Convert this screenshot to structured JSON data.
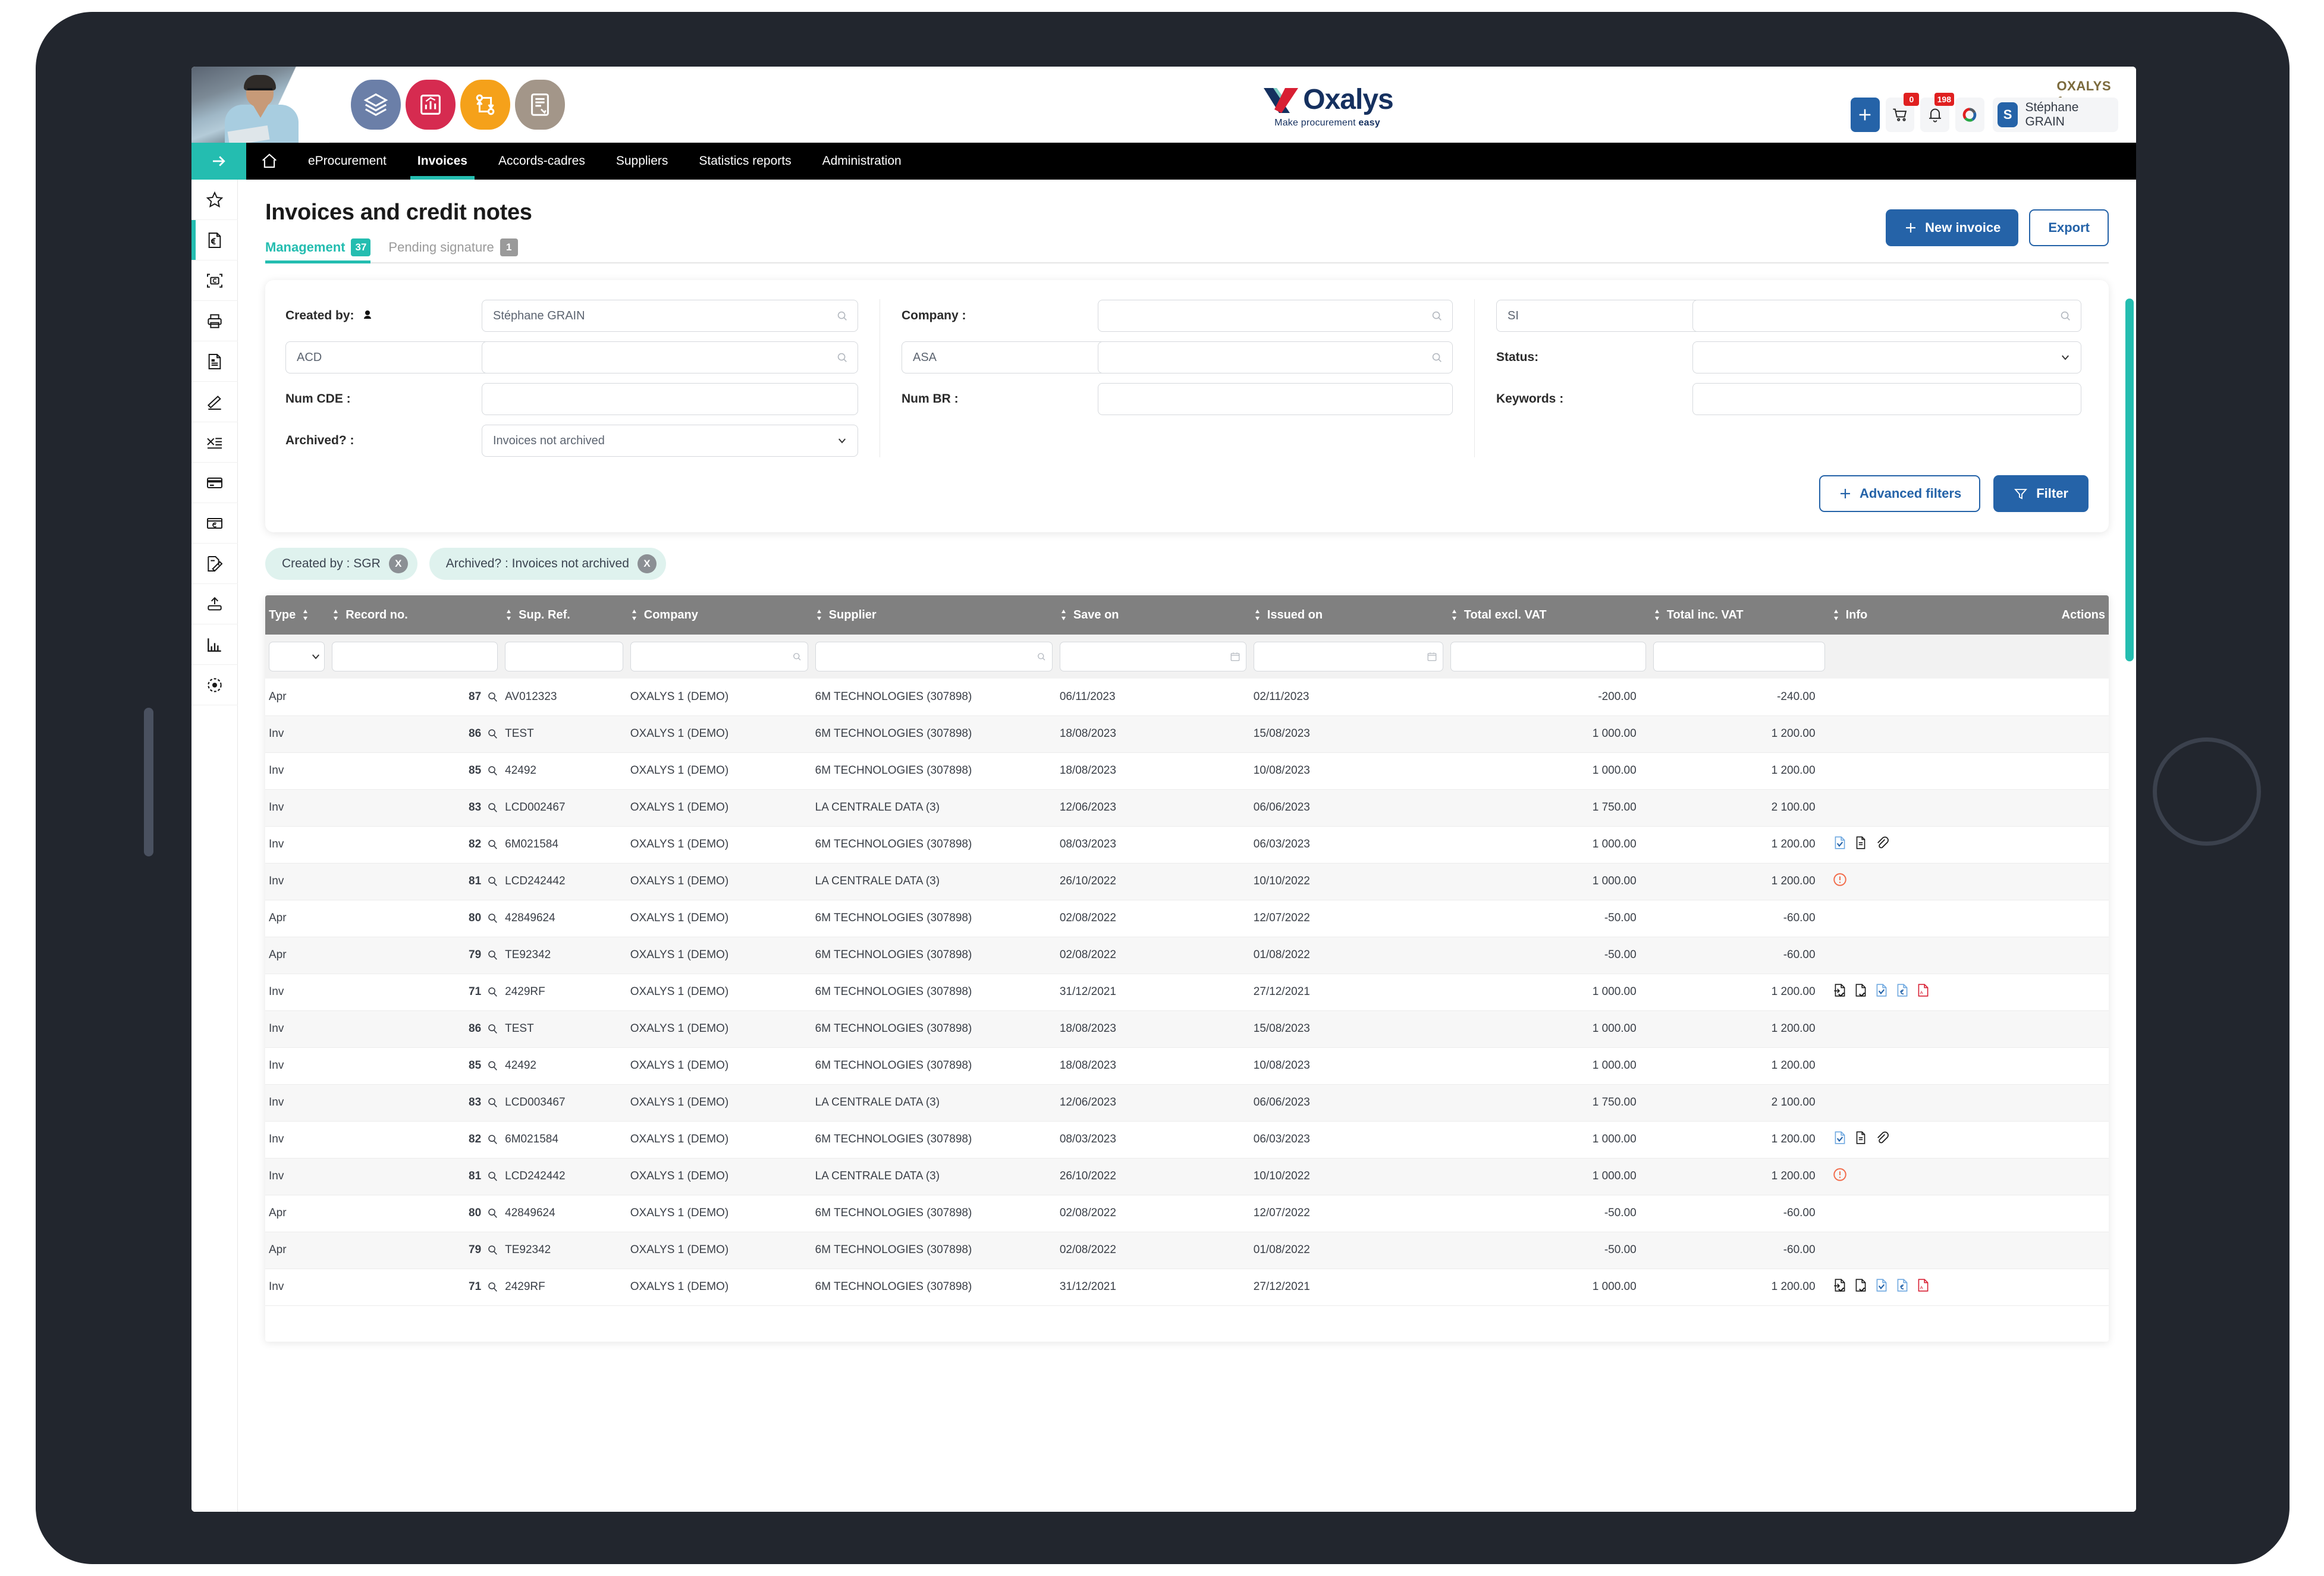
{
  "brand": {
    "logo_text": "Oxalys",
    "tagline_normal": "Make procurement ",
    "tagline_bold": "easy",
    "accent_teal": "#24bdb0",
    "accent_blue": "#2563a8",
    "nav_bg": "#000000",
    "header_row_bg": "#808080"
  },
  "topbar": {
    "org": "OXALYS 1",
    "cart_badge": "0",
    "bell_badge": "198",
    "user_initial": "S",
    "user_name": "Stéphane GRAIN",
    "app_icons": [
      "catalog-icon",
      "reports-icon",
      "workflow-icon",
      "contracts-icon"
    ]
  },
  "nav": {
    "toggle_icon": "arrow-right-icon",
    "home_icon": "home-icon",
    "items": [
      {
        "label": "eProcurement",
        "active": false
      },
      {
        "label": "Invoices",
        "active": true
      },
      {
        "label": "Accords-cadres",
        "active": false
      },
      {
        "label": "Suppliers",
        "active": false
      },
      {
        "label": "Statistics reports",
        "active": false
      },
      {
        "label": "Administration",
        "active": false
      }
    ]
  },
  "rail": {
    "items": [
      {
        "icon": "star-icon",
        "active": false
      },
      {
        "icon": "invoice-euro-icon",
        "active": true
      },
      {
        "icon": "scan-invoice-icon",
        "active": false
      },
      {
        "icon": "print-icon",
        "active": false
      },
      {
        "icon": "document-icon",
        "active": false
      },
      {
        "icon": "signature-pen-icon",
        "active": false
      },
      {
        "icon": "excel-export-icon",
        "active": false
      },
      {
        "icon": "payment-card-icon",
        "active": false
      },
      {
        "icon": "euro-card-icon",
        "active": false
      },
      {
        "icon": "document-edit-icon",
        "active": false
      },
      {
        "icon": "upload-icon",
        "active": false
      },
      {
        "icon": "bar-chart-icon",
        "active": false
      },
      {
        "icon": "target-icon",
        "active": false
      }
    ]
  },
  "page": {
    "title": "Invoices and credit notes",
    "tabs": [
      {
        "label": "Management",
        "count": "37",
        "active": true
      },
      {
        "label": "Pending signature",
        "count": "1",
        "active": false
      }
    ],
    "new_invoice_label": "New invoice",
    "export_label": "Export"
  },
  "filters": {
    "created_by_label": "Created by:",
    "created_by_value": "Stéphane GRAIN",
    "created_by_code": "ACD",
    "created_by_code2": "",
    "num_cde_label": "Num CDE :",
    "num_cde_value": "",
    "archived_label": "Archived? :",
    "archived_value": "Invoices not archived",
    "company_label": "Company :",
    "company_value": "",
    "company_code": "ASA",
    "company_code2": "",
    "num_br_label": "Num BR :",
    "num_br_value": "",
    "si_value": "SI",
    "si_search_value": "",
    "status_label": "Status:",
    "status_value": "",
    "keywords_label": "Keywords :",
    "keywords_value": "",
    "advanced_filters_label": "Advanced filters",
    "filter_label": "Filter"
  },
  "chips": [
    {
      "label": "Created by : SGR",
      "close": "X"
    },
    {
      "label": "Archived? : Invoices not archived",
      "close": "X"
    }
  ],
  "table": {
    "columns": [
      {
        "key": "type",
        "label": "Type",
        "sortable": true,
        "align": "left"
      },
      {
        "key": "record",
        "label": "Record no.",
        "sortable": true,
        "align": "left"
      },
      {
        "key": "ref",
        "label": "Sup. Ref.",
        "sortable": true,
        "align": "left"
      },
      {
        "key": "comp",
        "label": "Company",
        "sortable": true,
        "align": "left"
      },
      {
        "key": "sup",
        "label": "Supplier",
        "sortable": true,
        "align": "left"
      },
      {
        "key": "save",
        "label": "Save on",
        "sortable": true,
        "align": "left"
      },
      {
        "key": "issue",
        "label": "Issued on",
        "sortable": true,
        "align": "left"
      },
      {
        "key": "texcl",
        "label": "Total excl. VAT",
        "sortable": true,
        "align": "left"
      },
      {
        "key": "tincl",
        "label": "Total inc. VAT",
        "sortable": true,
        "align": "left"
      },
      {
        "key": "info",
        "label": "Info",
        "sortable": true,
        "align": "left"
      },
      {
        "key": "act",
        "label": "Actions",
        "sortable": false,
        "align": "right"
      }
    ],
    "rows": [
      {
        "type": "Apr",
        "record": "87",
        "ref": "AV012323",
        "comp": "OXALYS 1 (DEMO)",
        "sup": "6M TECHNOLOGIES (307898)",
        "save": "06/11/2023",
        "issue": "02/11/2023",
        "texcl": "-200.00",
        "tincl": "-240.00",
        "info": [],
        "actions": []
      },
      {
        "type": "Inv",
        "record": "86",
        "ref": "TEST",
        "comp": "OXALYS 1 (DEMO)",
        "sup": "6M TECHNOLOGIES (307898)",
        "save": "18/08/2023",
        "issue": "15/08/2023",
        "texcl": "1 000.00",
        "tincl": "1 200.00",
        "info": [],
        "actions": []
      },
      {
        "type": "Inv",
        "record": "85",
        "ref": "42492",
        "comp": "OXALYS 1 (DEMO)",
        "sup": "6M TECHNOLOGIES (307898)",
        "save": "18/08/2023",
        "issue": "10/08/2023",
        "texcl": "1 000.00",
        "tincl": "1 200.00",
        "info": [],
        "actions": []
      },
      {
        "type": "Inv",
        "record": "83",
        "ref": "LCD002467",
        "comp": "OXALYS 1 (DEMO)",
        "sup": "LA CENTRALE DATA (3)",
        "save": "12/06/2023",
        "issue": "06/06/2023",
        "texcl": "1 750.00",
        "tincl": "2 100.00",
        "info": [],
        "actions": []
      },
      {
        "type": "Inv",
        "record": "82",
        "ref": "6M021584",
        "comp": "OXALYS 1 (DEMO)",
        "sup": "6M TECHNOLOGIES (307898)",
        "save": "08/03/2023",
        "issue": "06/03/2023",
        "texcl": "1 000.00",
        "tincl": "1 200.00",
        "info": [
          "doc-blue-check-icon",
          "doc-dark-icon",
          "paperclip-icon"
        ],
        "actions": []
      },
      {
        "type": "Inv",
        "record": "81",
        "ref": "LCD242442",
        "comp": "OXALYS 1 (DEMO)",
        "sup": "LA CENTRALE DATA (3)",
        "save": "26/10/2022",
        "issue": "10/10/2022",
        "texcl": "1 000.00",
        "tincl": "1 200.00",
        "info": [
          "warning-icon"
        ],
        "actions": []
      },
      {
        "type": "Apr",
        "record": "80",
        "ref": "42849624",
        "comp": "OXALYS 1 (DEMO)",
        "sup": "6M TECHNOLOGIES (307898)",
        "save": "02/08/2022",
        "issue": "12/07/2022",
        "texcl": "-50.00",
        "tincl": "-60.00",
        "info": [],
        "actions": []
      },
      {
        "type": "Apr",
        "record": "79",
        "ref": "TE92342",
        "comp": "OXALYS 1 (DEMO)",
        "sup": "6M TECHNOLOGIES (307898)",
        "save": "02/08/2022",
        "issue": "01/08/2022",
        "texcl": "-50.00",
        "tincl": "-60.00",
        "info": [],
        "actions": []
      },
      {
        "type": "Inv",
        "record": "71",
        "ref": "2429RF",
        "comp": "OXALYS 1 (DEMO)",
        "sup": "6M TECHNOLOGIES (307898)",
        "save": "31/12/2021",
        "issue": "27/12/2021",
        "texcl": "1 000.00",
        "tincl": "1 200.00",
        "info": [
          "doc-in-check-icon",
          "doc-out-check-icon",
          "doc-blue-check-icon",
          "doc-euro-icon",
          "pdf-icon"
        ],
        "actions": []
      },
      {
        "type": "Inv",
        "record": "86",
        "ref": "TEST",
        "comp": "OXALYS 1 (DEMO)",
        "sup": "6M TECHNOLOGIES (307898)",
        "save": "18/08/2023",
        "issue": "15/08/2023",
        "texcl": "1 000.00",
        "tincl": "1 200.00",
        "info": [],
        "actions": []
      },
      {
        "type": "Inv",
        "record": "85",
        "ref": "42492",
        "comp": "OXALYS 1 (DEMO)",
        "sup": "6M TECHNOLOGIES (307898)",
        "save": "18/08/2023",
        "issue": "10/08/2023",
        "texcl": "1 000.00",
        "tincl": "1 200.00",
        "info": [],
        "actions": []
      },
      {
        "type": "Inv",
        "record": "83",
        "ref": "LCD003467",
        "comp": "OXALYS 1 (DEMO)",
        "sup": "LA CENTRALE DATA (3)",
        "save": "12/06/2023",
        "issue": "06/06/2023",
        "texcl": "1 750.00",
        "tincl": "2 100.00",
        "info": [],
        "actions": []
      },
      {
        "type": "Inv",
        "record": "82",
        "ref": "6M021584",
        "comp": "OXALYS 1 (DEMO)",
        "sup": "6M TECHNOLOGIES (307898)",
        "save": "08/03/2023",
        "issue": "06/03/2023",
        "texcl": "1 000.00",
        "tincl": "1 200.00",
        "info": [
          "doc-blue-check-icon",
          "doc-dark-icon",
          "paperclip-icon"
        ],
        "actions": []
      },
      {
        "type": "Inv",
        "record": "81",
        "ref": "LCD242442",
        "comp": "OXALYS 1 (DEMO)",
        "sup": "LA CENTRALE DATA (3)",
        "save": "26/10/2022",
        "issue": "10/10/2022",
        "texcl": "1 000.00",
        "tincl": "1 200.00",
        "info": [
          "warning-icon"
        ],
        "actions": []
      },
      {
        "type": "Apr",
        "record": "80",
        "ref": "42849624",
        "comp": "OXALYS 1 (DEMO)",
        "sup": "6M TECHNOLOGIES (307898)",
        "save": "02/08/2022",
        "issue": "12/07/2022",
        "texcl": "-50.00",
        "tincl": "-60.00",
        "info": [],
        "actions": []
      },
      {
        "type": "Apr",
        "record": "79",
        "ref": "TE92342",
        "comp": "OXALYS 1 (DEMO)",
        "sup": "6M TECHNOLOGIES (307898)",
        "save": "02/08/2022",
        "issue": "01/08/2022",
        "texcl": "-50.00",
        "tincl": "-60.00",
        "info": [],
        "actions": []
      },
      {
        "type": "Inv",
        "record": "71",
        "ref": "2429RF",
        "comp": "OXALYS 1 (DEMO)",
        "sup": "6M TECHNOLOGIES (307898)",
        "save": "31/12/2021",
        "issue": "27/12/2021",
        "texcl": "1 000.00",
        "tincl": "1 200.00",
        "info": [
          "doc-in-check-icon",
          "doc-out-check-icon",
          "doc-blue-check-icon",
          "doc-euro-icon",
          "pdf-icon"
        ],
        "actions": []
      }
    ]
  }
}
